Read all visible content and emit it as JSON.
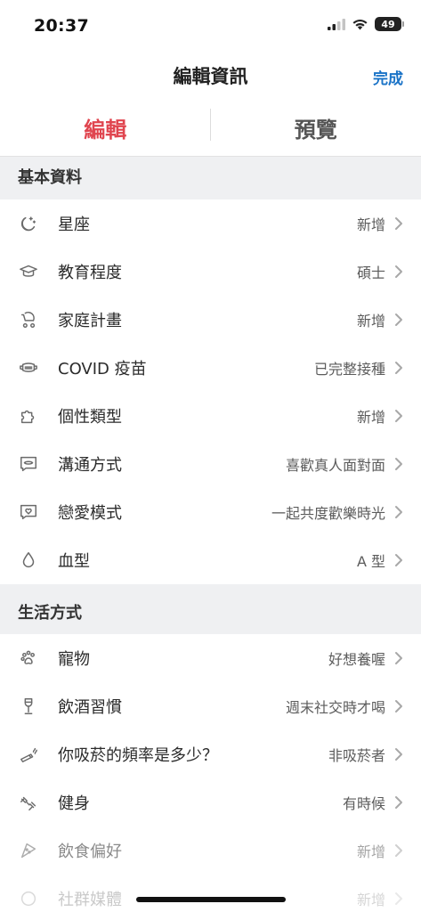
{
  "status_bar": {
    "time": "20:37",
    "battery": "49"
  },
  "nav": {
    "title": "編輯資訊",
    "done": "完成"
  },
  "tabs": {
    "edit": "編輯",
    "preview": "預覽"
  },
  "sections": {
    "basic": {
      "title": "基本資料",
      "items": [
        {
          "label": "星座",
          "value": "新增",
          "icon": "moon-stars-icon"
        },
        {
          "label": "教育程度",
          "value": "碩士",
          "icon": "graduation-cap-icon"
        },
        {
          "label": "家庭計畫",
          "value": "新增",
          "icon": "baby-stroller-icon"
        },
        {
          "label": "COVID 疫苗",
          "value": "已完整接種",
          "icon": "face-mask-icon"
        },
        {
          "label": "個性類型",
          "value": "新增",
          "icon": "puzzle-icon"
        },
        {
          "label": "溝通方式",
          "value": "喜歡真人面對面",
          "icon": "chat-lips-icon"
        },
        {
          "label": "戀愛模式",
          "value": "一起共度歡樂時光",
          "icon": "chat-heart-icon"
        },
        {
          "label": "血型",
          "value": "A 型",
          "icon": "drop-icon"
        }
      ]
    },
    "lifestyle": {
      "title": "生活方式",
      "items": [
        {
          "label": "寵物",
          "value": "好想養喔",
          "icon": "paw-icon"
        },
        {
          "label": "飲酒習慣",
          "value": "週末社交時才喝",
          "icon": "wine-glass-icon"
        },
        {
          "label": "你吸菸的頻率是多少？",
          "value": "非吸菸者",
          "icon": "cigarette-icon"
        },
        {
          "label": "健身",
          "value": "有時候",
          "icon": "dumbbell-icon"
        },
        {
          "label": "飲食偏好",
          "value": "新增",
          "icon": "pizza-icon"
        },
        {
          "label": "社群媒體",
          "value": "新增",
          "icon": "social-icon"
        }
      ]
    }
  }
}
